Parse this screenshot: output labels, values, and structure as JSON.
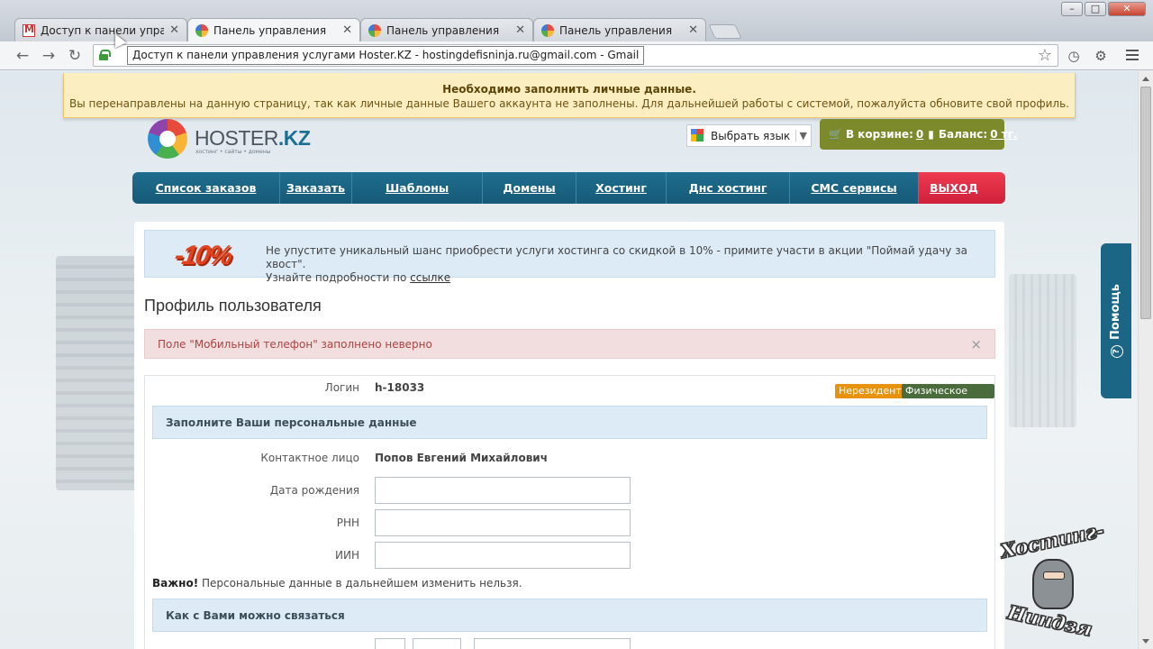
{
  "browser": {
    "tabs": [
      {
        "label": "Доступ к панели управле",
        "icon": "gmail-icon",
        "active": false
      },
      {
        "label": "Панель управления",
        "icon": "hoster-icon",
        "active": true
      },
      {
        "label": "Панель управления",
        "icon": "hoster-icon",
        "active": false
      },
      {
        "label": "Панель управления",
        "icon": "hoster-icon",
        "active": false
      }
    ],
    "tooltip": "Доступ к панели управления услугами Hoster.KZ - hostingdefisninja.ru@gmail.com - Gmail",
    "window_controls": {
      "minimize": "–",
      "maximize": "□",
      "close": "✕"
    }
  },
  "notice": {
    "title": "Необходимо заполнить личные данные.",
    "text": "Вы перенаправлены на данную страницу, так как личные данные Вашего аккаунта не заполнены. Для дальнейшей работы с системой, пожалуйста обновите свой профиль."
  },
  "logo": {
    "name_a": "HOSTER",
    "name_b": ".KZ",
    "tagline": "хостинг • сайты • домены"
  },
  "language": {
    "label": "Выбрать язык",
    "arrow": "▼"
  },
  "cart": {
    "cart_label": "В корзине:",
    "cart_value": "0",
    "balance_label": "Баланс:",
    "balance_value": "0 тг."
  },
  "nav": {
    "items": [
      "Список заказов",
      "Заказать",
      "Шаблоны",
      "Домены",
      "Хостинг",
      "Днс хостинг",
      "СМС сервисы"
    ],
    "exit": "Выход"
  },
  "promo": {
    "badge": "-10%",
    "line1": "Не упустите уникальный шанс приобрести услуги хостинга со скидкой в 10% - примите участи в акции \"Поймай удачу за хвост\".",
    "line2_prefix": "Узнайте подробности по",
    "link": "ссылке"
  },
  "page_title": "Профиль пользователя",
  "error": {
    "text": "Поле \"Мобильный телефон\" заполнено неверно",
    "close": "×"
  },
  "form": {
    "login_label": "Логин",
    "login_value": "h-18033",
    "badges": [
      {
        "label": "Нерезидент",
        "color": "#e8930f"
      },
      {
        "label": "Физическое лицо",
        "color": "#4a6b3c"
      }
    ],
    "section_personal": "Заполните Ваши персональные данные",
    "contact_label": "Контактное лицо",
    "contact_value": "Попов Евгений Михайлович",
    "birth_label": "Дата рождения",
    "rnn_label": "РНН",
    "iin_label": "ИИН",
    "important_bold": "Важно!",
    "important_text": " Персональные данные в дальнейшем изменить нельзя.",
    "section_contact": "Как с Вами можно связаться"
  },
  "help": {
    "label": "Помощь",
    "icon": "?"
  },
  "watermark": {
    "line1": "Хостинг-",
    "line2": "Ниндзя"
  },
  "colors": {
    "nav": "#1f6d8e",
    "exit": "#e8304a",
    "cart": "#7d8a2b",
    "notice": "#fbeec1"
  }
}
